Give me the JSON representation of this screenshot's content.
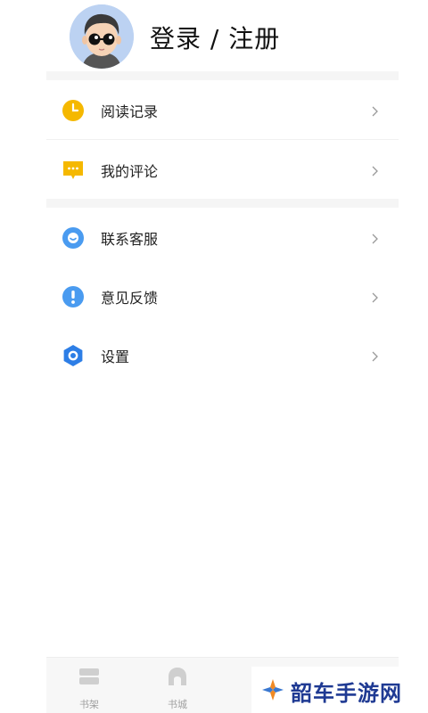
{
  "header": {
    "title": "登录 / 注册",
    "avatar_icon": "cartoon-avatar-icon"
  },
  "menu": {
    "items": [
      {
        "label": "阅读记录",
        "icon": "clock-icon",
        "color": "#F5B800"
      },
      {
        "label": "我的评论",
        "icon": "comment-icon",
        "color": "#F5B800"
      },
      {
        "label": "联系客服",
        "icon": "smile-icon",
        "color": "#4A9BF0"
      },
      {
        "label": "意见反馈",
        "icon": "exclamation-icon",
        "color": "#4A9BF0"
      },
      {
        "label": "设置",
        "icon": "hexagon-settings-icon",
        "color": "#2D7EE6"
      }
    ],
    "chevron_icon": "chevron-right-icon"
  },
  "tabbar": {
    "tabs": [
      {
        "label": "书架",
        "icon": "bookshelf-icon"
      },
      {
        "label": "书城",
        "icon": "bookstore-icon"
      }
    ]
  },
  "watermark": {
    "text": "韶车手游网",
    "color": "#1F3A93"
  }
}
